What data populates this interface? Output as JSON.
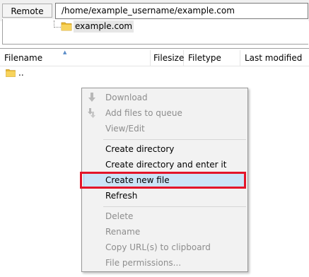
{
  "site_bar": {
    "label": "Remote site:",
    "path": "/home/example_username/example.com"
  },
  "tree": {
    "item_label": "example.com",
    "item_icon": "folder-icon"
  },
  "file_list": {
    "columns": [
      "Filename",
      "Filesize",
      "Filetype",
      "Last modified"
    ],
    "sort_indicator": "▲",
    "rows": [
      {
        "name": "..",
        "icon": "folder-icon"
      }
    ]
  },
  "context_menu": {
    "items": [
      {
        "label": "Download",
        "enabled": false,
        "icon": "download-icon"
      },
      {
        "label": "Add files to queue",
        "enabled": false,
        "icon": "add-to-queue-icon"
      },
      {
        "label": "View/Edit",
        "enabled": false
      },
      {
        "label": "Create directory",
        "enabled": true
      },
      {
        "label": "Create directory and enter it",
        "enabled": true
      },
      {
        "label": "Create new file",
        "enabled": true,
        "highlighted": true
      },
      {
        "label": "Refresh",
        "enabled": true
      },
      {
        "label": "Delete",
        "enabled": false
      },
      {
        "label": "Rename",
        "enabled": false
      },
      {
        "label": "Copy URL(s) to clipboard",
        "enabled": false
      },
      {
        "label": "File permissions...",
        "enabled": false
      }
    ]
  },
  "colors": {
    "highlight_border": "#e3152a",
    "hover_background": "#cce4f7",
    "folder_yellow": "#f5c542",
    "disabled_text": "#8d8d8d"
  }
}
